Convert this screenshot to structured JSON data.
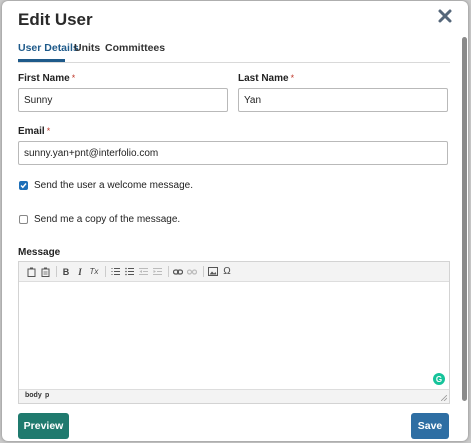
{
  "modal": {
    "title": "Edit User"
  },
  "tabs": [
    {
      "label": "User Details",
      "active": true
    },
    {
      "label": "Units",
      "active": false
    },
    {
      "label": "Committees",
      "active": false
    }
  ],
  "form": {
    "first_name": {
      "label": "First Name",
      "required_mark": "*",
      "value": "Sunny"
    },
    "last_name": {
      "label": "Last Name",
      "required_mark": "*",
      "value": "Yan"
    },
    "email": {
      "label": "Email",
      "required_mark": "*",
      "value": "sunny.yan+pnt@interfolio.com"
    },
    "welcome": {
      "label": "Send the user a welcome message.",
      "checked": true
    },
    "copy": {
      "label": "Send me a copy of the message.",
      "checked": false
    },
    "message": {
      "label": "Message",
      "value": ""
    }
  },
  "editor": {
    "toolbar_icons": [
      "paste-icon",
      "paste-text-icon",
      "bold-icon",
      "italic-icon",
      "remove-format-icon",
      "numbered-list-icon",
      "bulleted-list-icon",
      "outdent-icon",
      "indent-icon",
      "link-icon",
      "unlink-icon",
      "image-icon",
      "special-char-icon"
    ],
    "glyphs": {
      "bold": "B",
      "italic": "I",
      "remove_format": "Tx",
      "special_char": "Ω"
    },
    "path": [
      "body",
      "p"
    ],
    "grammarly_glyph": "G"
  },
  "buttons": {
    "preview": "Preview",
    "save": "Save"
  },
  "colors": {
    "primary": "#1e5a8a",
    "preview_bg": "#1f7a6e",
    "save_bg": "#2e6ea3",
    "required": "#c0392b",
    "checkbox": "#1e6fb8"
  }
}
